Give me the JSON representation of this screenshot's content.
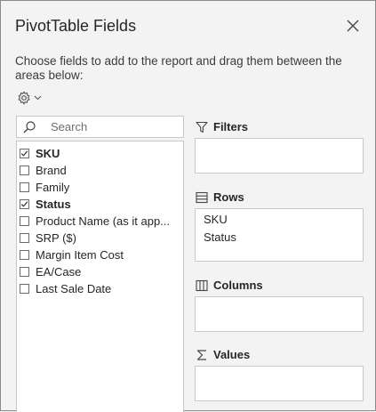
{
  "header": {
    "title": "PivotTable Fields",
    "close_icon": "close-icon"
  },
  "instructions": "Choose fields to add to the report and drag them between the areas below:",
  "tools": {
    "icon": "gear-icon",
    "dropdown_icon": "chevron-down-icon"
  },
  "search": {
    "placeholder": "Search",
    "value": ""
  },
  "fields": [
    {
      "label": "SKU",
      "checked": true
    },
    {
      "label": "Brand",
      "checked": false
    },
    {
      "label": "Family",
      "checked": false
    },
    {
      "label": "Status",
      "checked": true
    },
    {
      "label": "Product Name (as it app...",
      "checked": false
    },
    {
      "label": "SRP ($)",
      "checked": false
    },
    {
      "label": "Margin Item Cost",
      "checked": false
    },
    {
      "label": "EA/Case",
      "checked": false
    },
    {
      "label": "Last Sale Date",
      "checked": false
    }
  ],
  "areas": {
    "filters": {
      "label": "Filters",
      "icon": "filter-icon",
      "items": []
    },
    "rows": {
      "label": "Rows",
      "icon": "rows-icon",
      "items": [
        "SKU",
        "Status"
      ]
    },
    "columns": {
      "label": "Columns",
      "icon": "columns-icon",
      "items": []
    },
    "values": {
      "label": "Values",
      "icon": "sigma-icon",
      "items": []
    }
  },
  "colors": {
    "background": "#f3f3f3",
    "box": "#ffffff",
    "border": "#c8c8c8",
    "text": "#262626"
  }
}
